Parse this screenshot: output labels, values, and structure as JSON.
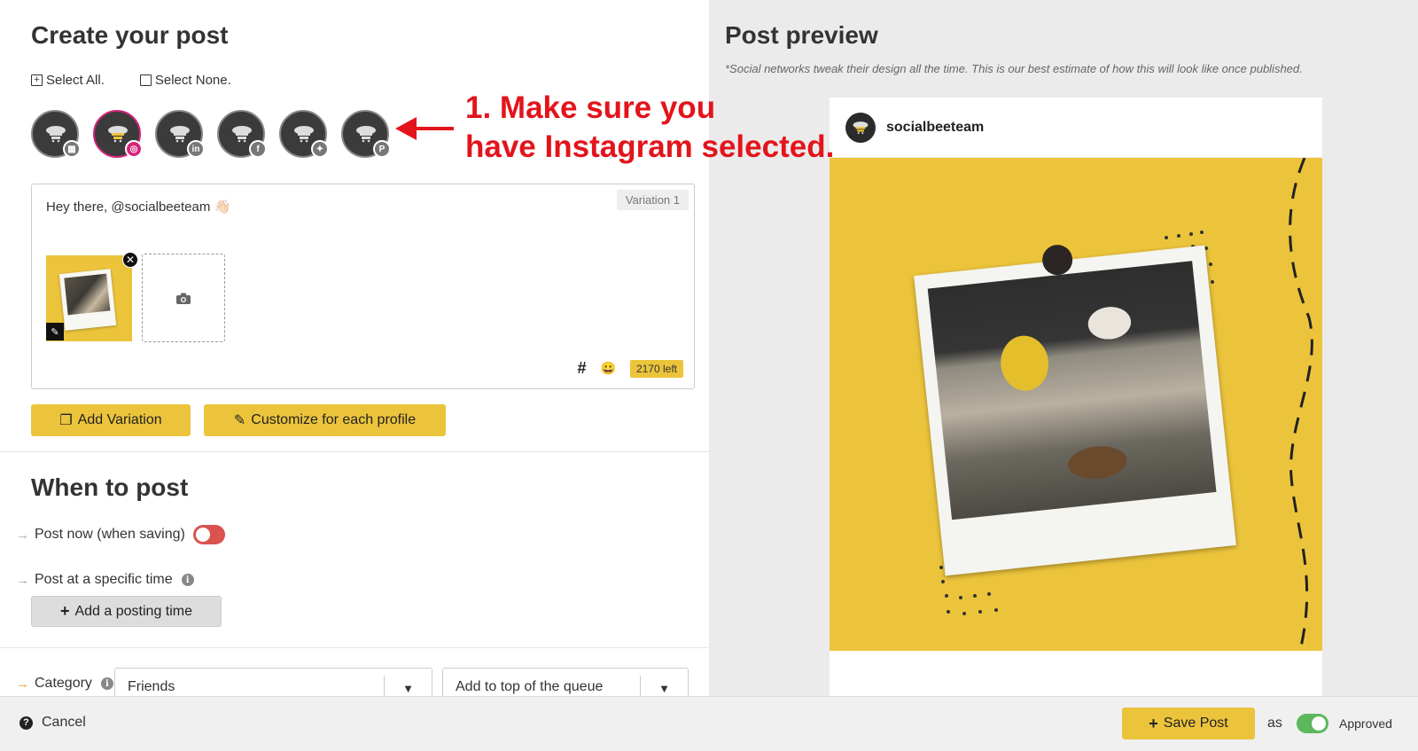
{
  "create": {
    "title": "Create your post",
    "select_all": "Select All.",
    "select_none": "Select None."
  },
  "profiles": [
    {
      "network": "google-business",
      "badge_icon": "store-icon",
      "badge_glyph": "▦",
      "selected": false
    },
    {
      "network": "instagram",
      "badge_icon": "instagram-icon",
      "badge_glyph": "◎",
      "selected": true
    },
    {
      "network": "linkedin",
      "badge_icon": "linkedin-icon",
      "badge_glyph": "in",
      "selected": false
    },
    {
      "network": "facebook",
      "badge_icon": "facebook-icon",
      "badge_glyph": "f",
      "selected": false
    },
    {
      "network": "twitter",
      "badge_icon": "twitter-icon",
      "badge_glyph": "✦",
      "selected": false
    },
    {
      "network": "pinterest",
      "badge_icon": "pinterest-icon",
      "badge_glyph": "P",
      "selected": false
    }
  ],
  "annotation": {
    "line1": "1. Make sure you",
    "line2": "have Instagram selected.",
    "color": "#e3141b"
  },
  "editor": {
    "variation_label": "Variation 1",
    "text": "Hey there, @socialbeeteam 👋🏻",
    "hashtag_symbol": "#",
    "emoji_symbol": "😀",
    "chars_left": "2170 left"
  },
  "actions": {
    "add_variation": "Add Variation",
    "customize": "Customize for each profile"
  },
  "when": {
    "title": "When to post",
    "post_now": "Post now (when saving)",
    "post_specific": "Post at a specific time",
    "add_posting_time": "Add a posting time"
  },
  "category": {
    "label": "Category",
    "selected": "Friends",
    "queue_option": "Add to top of the queue"
  },
  "preview": {
    "title": "Post preview",
    "note": "*Social networks tweak their design all the time. This is our best estimate of how this will look like once published.",
    "username": "socialbeeteam"
  },
  "footer": {
    "cancel": "Cancel",
    "save": "Save Post",
    "as_label": "as",
    "status": "Approved"
  },
  "colors": {
    "accent_yellow": "#ecc43c",
    "instagram_pink": "#d6247b",
    "toggle_off": "#d9534f",
    "toggle_on": "#5cb85c"
  }
}
